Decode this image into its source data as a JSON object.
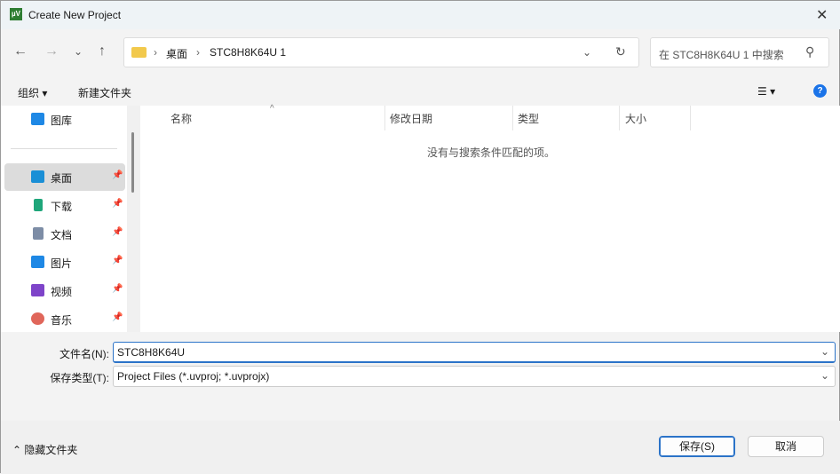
{
  "window": {
    "title": "Create New Project",
    "app_icon_text": "µV"
  },
  "nav": {
    "back": "←",
    "forward": "→",
    "recent": "⌄",
    "up": "↑"
  },
  "address": {
    "breadcrumbs": [
      "桌面",
      "STC8H8K64U 1"
    ],
    "sep": "›",
    "dropdown": "⌄",
    "refresh": "↻"
  },
  "search": {
    "placeholder": "在 STC8H8K64U 1 中搜索",
    "icon": "⚲"
  },
  "toolbar": {
    "organize": "组织 ▾",
    "new_folder": "新建文件夹",
    "view": "☰ ▾",
    "help": "?"
  },
  "sidebar": {
    "top_item": "图库",
    "items": [
      {
        "label": "桌面",
        "color": "#1a8fd6",
        "pinned": true,
        "selected": true
      },
      {
        "label": "下载",
        "color": "#1fa67a",
        "pinned": true
      },
      {
        "label": "文档",
        "color": "#7d8da6",
        "pinned": true
      },
      {
        "label": "图片",
        "color": "#1e88e5",
        "pinned": true
      },
      {
        "label": "视频",
        "color": "#7e44c9",
        "pinned": true
      },
      {
        "label": "音乐",
        "color": "#e0665a",
        "pinned": true
      }
    ],
    "pin": "📌"
  },
  "columns": [
    "名称",
    "修改日期",
    "类型",
    "大小"
  ],
  "empty_message": "没有与搜索条件匹配的项。",
  "filename": {
    "label": "文件名(N):",
    "value": "STC8H8K64U"
  },
  "filetype": {
    "label": "保存类型(T):",
    "value": "Project Files (*.uvproj; *.uvprojx)"
  },
  "footer": {
    "hide_folders": "隐藏文件夹",
    "save": "保存(S)",
    "cancel": "取消"
  }
}
